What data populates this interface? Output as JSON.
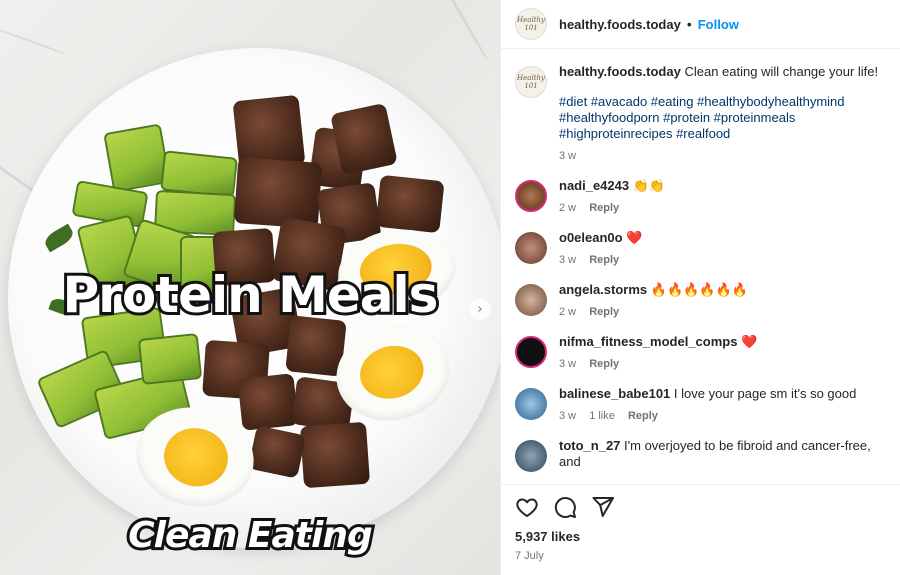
{
  "media": {
    "overlay_title": "Protein Meals",
    "overlay_subtitle": "Clean Eating",
    "next_icon": "chevron-right-icon"
  },
  "header": {
    "username": "healthy.foods.today",
    "separator": "•",
    "follow_label": "Follow",
    "avatar_text": "Healthy 101"
  },
  "caption": {
    "username": "healthy.foods.today",
    "text": "Clean eating will change your life!",
    "hashtags": "#diet #avacado #eating #healthybodyhealthymind #healthyfoodporn #protein #proteinmeals #highproteinrecipes #realfood",
    "time": "3 w"
  },
  "comments": [
    {
      "username": "nadi_e4243",
      "text": "👏👏",
      "time": "2 w",
      "likes": "",
      "reply": "Reply"
    },
    {
      "username": "o0elean0o",
      "text": "❤️",
      "time": "3 w",
      "likes": "",
      "reply": "Reply"
    },
    {
      "username": "angela.storms",
      "text": "🔥🔥🔥🔥🔥🔥",
      "time": "2 w",
      "likes": "",
      "reply": "Reply"
    },
    {
      "username": "nifma_fitness_model_comps",
      "text": "❤️",
      "time": "3 w",
      "likes": "",
      "reply": "Reply"
    },
    {
      "username": "balinese_babe101",
      "text": "I love your page sm it's so good",
      "time": "3 w",
      "likes": "1 like",
      "reply": "Reply"
    },
    {
      "username": "toto_n_27",
      "text": "I'm overjoyed to be fibroid and cancer-free, and",
      "time": "",
      "likes": "",
      "reply": ""
    }
  ],
  "actions": {
    "like_icon": "heart-icon",
    "comment_icon": "comment-icon",
    "share_icon": "share-icon",
    "likes_count": "5,937 likes",
    "date": "7 July"
  },
  "colors": {
    "link_blue": "#0095f6",
    "hashtag_blue": "#00376b",
    "muted": "#737373"
  }
}
